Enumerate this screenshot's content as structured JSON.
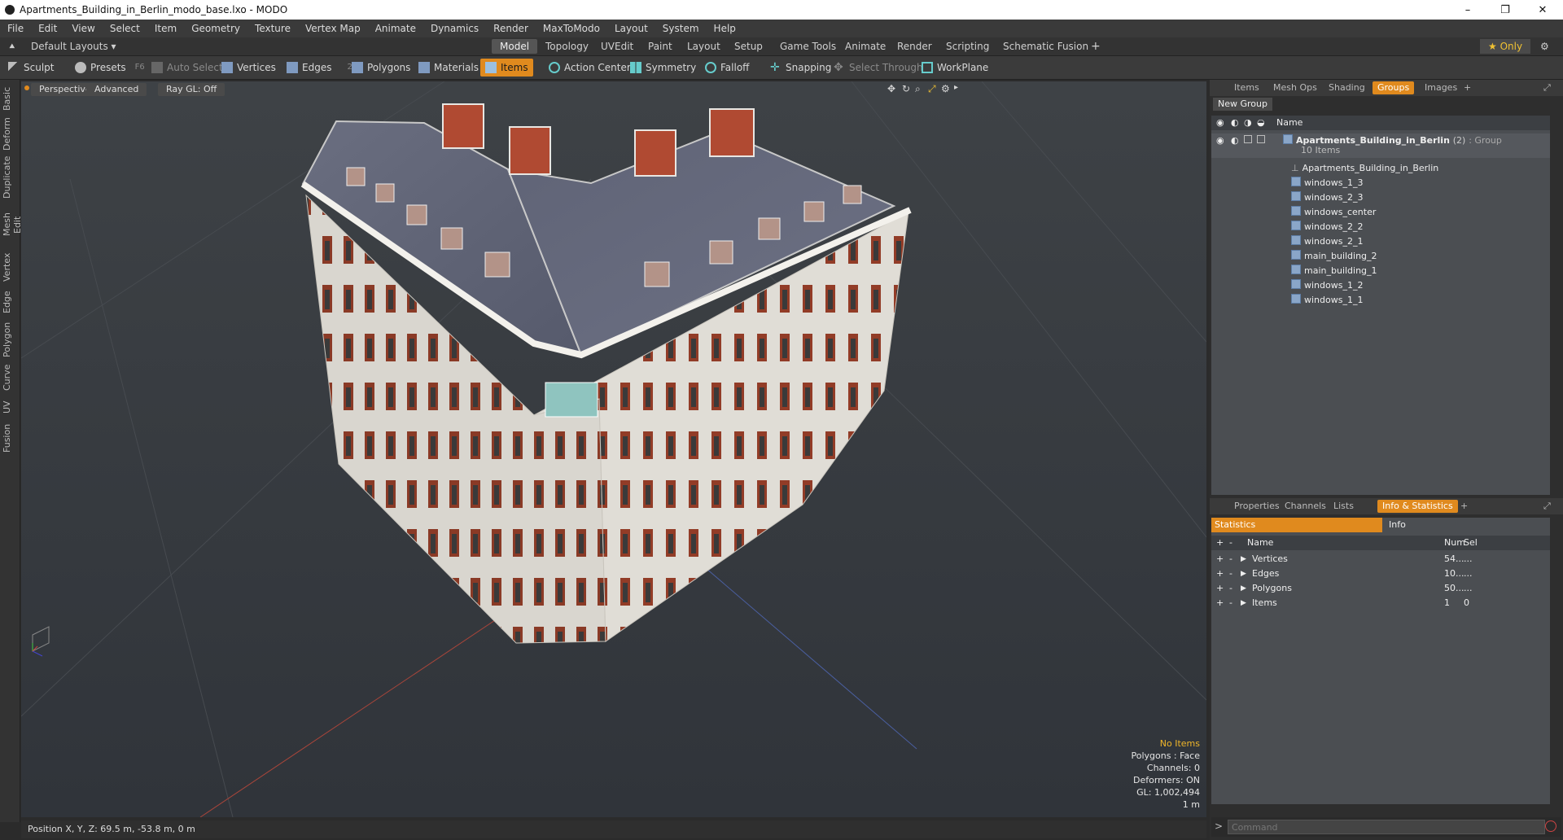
{
  "window": {
    "title": "Apartments_Building_in_Berlin_modo_base.lxo - MODO",
    "min": "–",
    "max": "❐",
    "close": "✕"
  },
  "menu": [
    "File",
    "Edit",
    "View",
    "Select",
    "Item",
    "Geometry",
    "Texture",
    "Vertex Map",
    "Animate",
    "Dynamics",
    "Render",
    "MaxToModo",
    "Layout",
    "System",
    "Help"
  ],
  "layoutbar": {
    "layouts_label": "Default Layouts ▾",
    "tabs": [
      "Model",
      "Topology",
      "UVEdit",
      "Paint",
      "Layout",
      "Setup",
      "Game Tools",
      "Animate",
      "Render",
      "Scripting",
      "Schematic Fusion"
    ],
    "active_tab": "Model",
    "add": "+",
    "only_label": "★ Only",
    "gear": "⚙"
  },
  "toolbar": {
    "sculpt": "Sculpt",
    "presets": "Presets",
    "presets_key": "F6",
    "auto_select": "Auto Select",
    "vertices": "Vertices",
    "vertices_num": "1",
    "edges": "Edges",
    "edges_num": "2",
    "polygons": "Polygons",
    "materials": "Materials",
    "items": "Items",
    "action_center": "Action Center",
    "symmetry": "Symmetry",
    "falloff": "Falloff",
    "snapping": "Snapping",
    "select_through": "Select Through",
    "workplane": "WorkPlane"
  },
  "left_tabs": [
    "Basic",
    "Deform",
    "Duplicate",
    "Mesh Edit",
    "Vertex",
    "Edge",
    "Polygon",
    "Curve",
    "UV",
    "Fusion"
  ],
  "viewport": {
    "view": "Perspective",
    "style": "Advanced",
    "raygl": "Ray GL: Off",
    "info": {
      "no_items": "No Items",
      "polygons": "Polygons : Face",
      "channels": "Channels: 0",
      "deformers": "Deformers: ON",
      "gl": "GL: 1,002,494",
      "scale": "1 m"
    }
  },
  "status": {
    "position": "Position X, Y, Z:  69.5 m, -53.8 m, 0 m"
  },
  "top_panel": {
    "tabs": [
      "Items",
      "Mesh Ops",
      "Shading",
      "Groups",
      "Images"
    ],
    "active_tab": "Groups",
    "new_group": "New Group",
    "col_name": "Name",
    "group_name": "Apartments_Building_in_Berlin",
    "group_count": "(2)",
    "group_type": ": Group",
    "group_items": "10 Items",
    "children": [
      "Apartments_Building_in_Berlin",
      "windows_1_3",
      "windows_2_3",
      "windows_center",
      "windows_2_2",
      "windows_2_1",
      "main_building_2",
      "main_building_1",
      "windows_1_2",
      "windows_1_1"
    ]
  },
  "bottom_panel": {
    "tabs": [
      "Properties",
      "Channels",
      "Lists",
      "Info & Statistics"
    ],
    "active_tab": "Info & Statistics",
    "subtabs": [
      "Statistics",
      "Info"
    ],
    "columns": [
      "Name",
      "Num",
      "Sel"
    ],
    "rows": [
      {
        "name": "Vertices",
        "num": "54...",
        "sel": "..."
      },
      {
        "name": "Edges",
        "num": "10...",
        "sel": "..."
      },
      {
        "name": "Polygons",
        "num": "50...",
        "sel": "..."
      },
      {
        "name": "Items",
        "num": "1",
        "sel": "0"
      }
    ]
  },
  "command": {
    "placeholder": "Command"
  }
}
